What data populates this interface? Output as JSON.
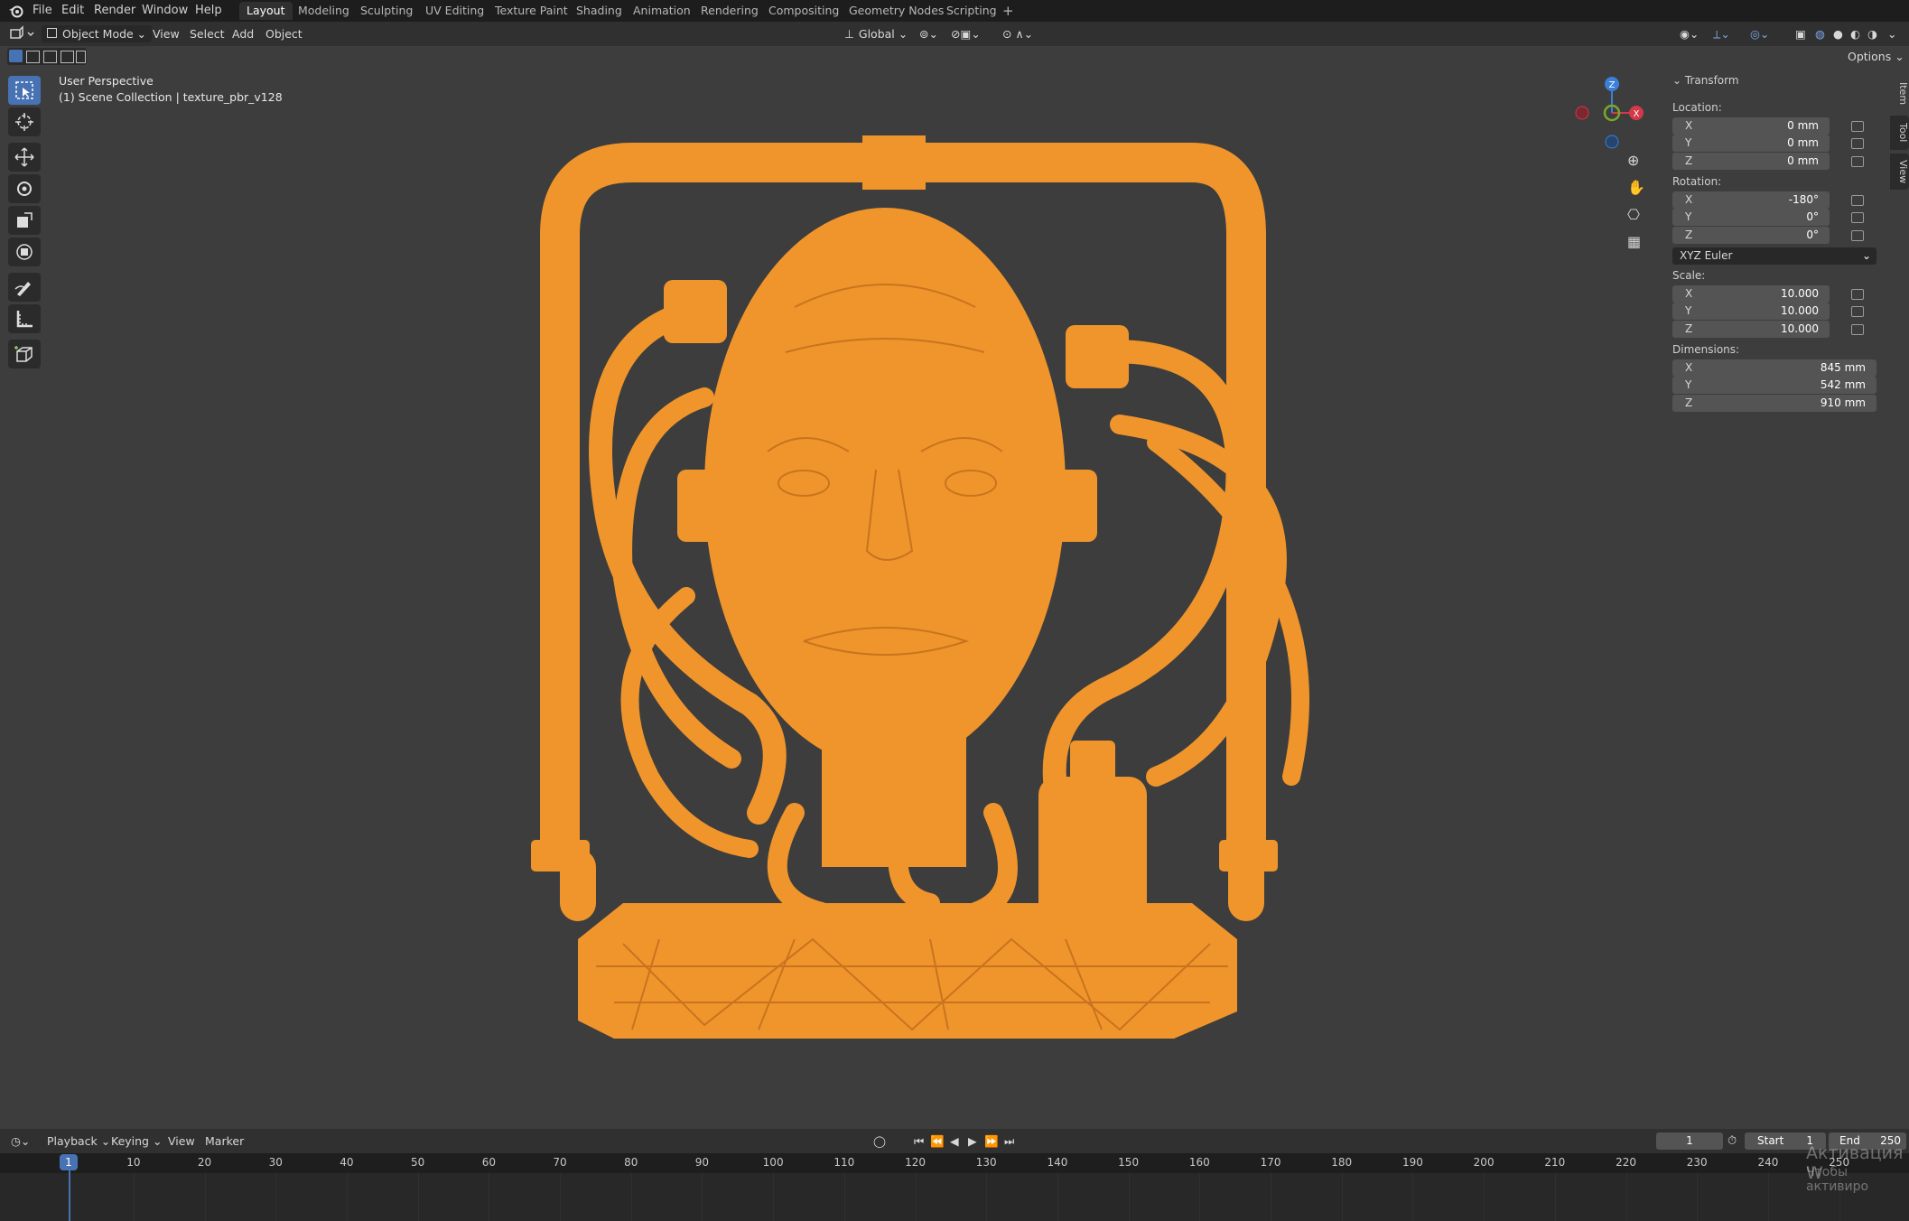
{
  "menu": {
    "file": "File",
    "edit": "Edit",
    "render": "Render",
    "window": "Window",
    "help": "Help"
  },
  "workspaces": [
    "Layout",
    "Modeling",
    "Sculpting",
    "UV Editing",
    "Texture Paint",
    "Shading",
    "Animation",
    "Rendering",
    "Compositing",
    "Geometry Nodes",
    "Scripting"
  ],
  "header": {
    "mode": "Object Mode",
    "view": "View",
    "select": "Select",
    "add": "Add",
    "object": "Object",
    "orientation": "Global",
    "options": "Options"
  },
  "viewport": {
    "perspective": "User Perspective",
    "collection": "(1) Scene Collection | texture_pbr_v128"
  },
  "gizmo": {
    "z": "Z",
    "y": "Y",
    "x": "X"
  },
  "npanel": {
    "section": "Transform",
    "location_label": "Location:",
    "location": [
      {
        "axis": "X",
        "value": "0 mm"
      },
      {
        "axis": "Y",
        "value": "0 mm"
      },
      {
        "axis": "Z",
        "value": "0 mm"
      }
    ],
    "rotation_label": "Rotation:",
    "rotation": [
      {
        "axis": "X",
        "value": "-180°"
      },
      {
        "axis": "Y",
        "value": "0°"
      },
      {
        "axis": "Z",
        "value": "0°"
      }
    ],
    "rotation_mode": "XYZ Euler",
    "scale_label": "Scale:",
    "scale": [
      {
        "axis": "X",
        "value": "10.000"
      },
      {
        "axis": "Y",
        "value": "10.000"
      },
      {
        "axis": "Z",
        "value": "10.000"
      }
    ],
    "dimensions_label": "Dimensions:",
    "dimensions": [
      {
        "axis": "X",
        "value": "845 mm"
      },
      {
        "axis": "Y",
        "value": "542 mm"
      },
      {
        "axis": "Z",
        "value": "910 mm"
      }
    ],
    "tabs": [
      "Item",
      "Tool",
      "View"
    ]
  },
  "timeline": {
    "playback": "Playback",
    "keying": "Keying",
    "view": "View",
    "marker": "Marker",
    "current_frame": "1",
    "start_label": "Start",
    "start": "1",
    "end_label": "End",
    "end": "250",
    "ticks": [
      "10",
      "20",
      "30",
      "40",
      "50",
      "60",
      "70",
      "80",
      "90",
      "100",
      "110",
      "120",
      "130",
      "140",
      "150",
      "160",
      "170",
      "180",
      "190",
      "200",
      "210",
      "220",
      "230",
      "240",
      "250"
    ],
    "playhead": "1"
  },
  "watermark": {
    "line1": "Активация W",
    "line2": "Чтобы активиро"
  },
  "colors": {
    "accent": "#4772b3",
    "selection": "#f0952b",
    "x_axis": "#d4394a",
    "y_axis": "#7aa82a",
    "z_axis": "#3b80d8"
  }
}
